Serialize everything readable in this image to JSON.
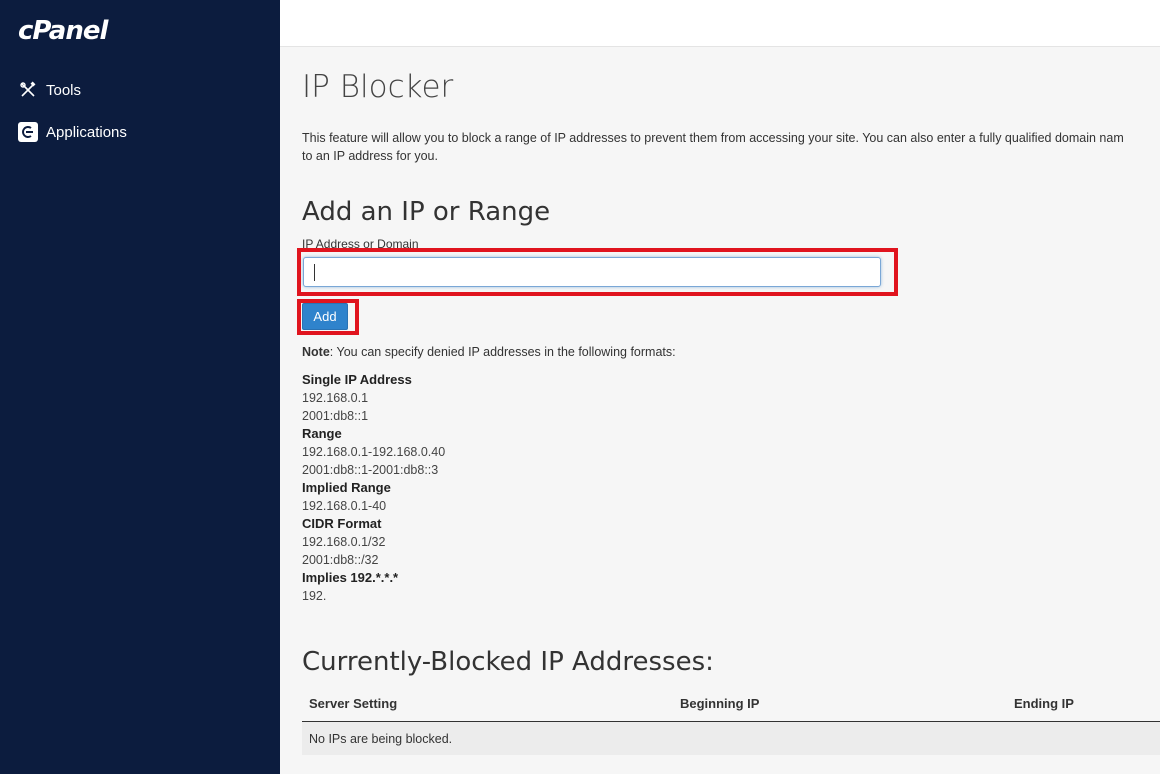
{
  "sidebar": {
    "logo": "cPanel",
    "items": [
      {
        "label": "Tools",
        "icon": "tools-icon"
      },
      {
        "label": "Applications",
        "icon": "applications-icon"
      }
    ]
  },
  "main": {
    "title": "IP Blocker",
    "description_line1": "This feature will allow you to block a range of IP addresses to prevent them from accessing your site. You can also enter a fully qualified domain nam",
    "description_line2": "to an IP address for you.",
    "add_section": {
      "heading": "Add an IP or Range",
      "field_label": "IP Address or Domain",
      "input_value": "",
      "add_button": "Add"
    },
    "note_label": "Note",
    "note_text": ": You can specify denied IP addresses in the following formats:",
    "formats": [
      {
        "heading": "Single IP Address",
        "examples": [
          "192.168.0.1",
          "2001:db8::1"
        ]
      },
      {
        "heading": "Range",
        "examples": [
          "192.168.0.1-192.168.0.40",
          "2001:db8::1-2001:db8::3"
        ]
      },
      {
        "heading": "Implied Range",
        "examples": [
          "192.168.0.1-40"
        ]
      },
      {
        "heading": "CIDR Format",
        "examples": [
          "192.168.0.1/32",
          "2001:db8::/32"
        ]
      },
      {
        "heading": "Implies 192.*.*.*",
        "examples": [
          "192."
        ]
      }
    ],
    "blocked_section": {
      "heading": "Currently-Blocked IP Addresses:",
      "columns": [
        "Server Setting",
        "Beginning IP",
        "Ending IP"
      ],
      "empty_message": "No IPs are being blocked."
    }
  },
  "colors": {
    "sidebar_bg": "#0c1c3e",
    "button_blue": "#2f83cc",
    "highlight_red": "#e0141e"
  }
}
